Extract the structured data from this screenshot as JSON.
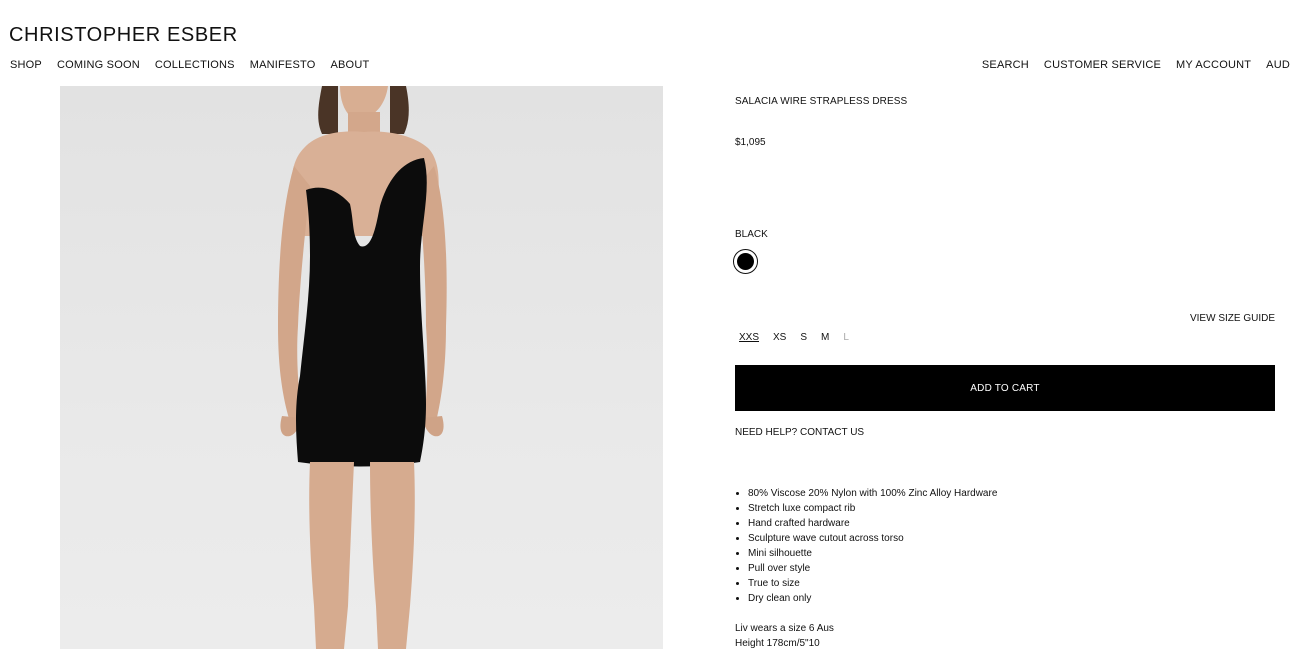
{
  "header": {
    "logo": "CHRISTOPHER ESBER",
    "nav_left": [
      "SHOP",
      "COMING SOON",
      "COLLECTIONS",
      "MANIFESTO",
      "ABOUT"
    ],
    "nav_right": [
      "SEARCH",
      "CUSTOMER SERVICE",
      "MY ACCOUNT",
      "AUD"
    ]
  },
  "product": {
    "title": "SALACIA WIRE STRAPLESS DRESS",
    "price": "$1,095",
    "color_label": "BLACK",
    "swatch_color": "#000000",
    "size_guide": "VIEW SIZE GUIDE",
    "sizes": [
      {
        "label": "XXS",
        "selected": true,
        "available": true
      },
      {
        "label": "XS",
        "selected": false,
        "available": true
      },
      {
        "label": "S",
        "selected": false,
        "available": true
      },
      {
        "label": "M",
        "selected": false,
        "available": true
      },
      {
        "label": "L",
        "selected": false,
        "available": false
      }
    ],
    "add_to_cart": "ADD TO CART",
    "help_text": "NEED HELP? CONTACT US",
    "features": [
      "80% Viscose 20% Nylon with 100% Zinc Alloy Hardware",
      "Stretch luxe compact rib",
      "Hand crafted hardware",
      "Sculpture wave cutout across torso",
      "Mini silhouette",
      "Pull over style",
      "True to size",
      "Dry clean only"
    ],
    "model_info": [
      "Liv wears a size 6 Aus",
      "Height 178cm/5\"10"
    ]
  },
  "colors": {
    "button_bg": "#000000",
    "button_text": "#ffffff",
    "image_bg": "#e6e6e6",
    "unavailable_size": "#aaaaaa"
  }
}
